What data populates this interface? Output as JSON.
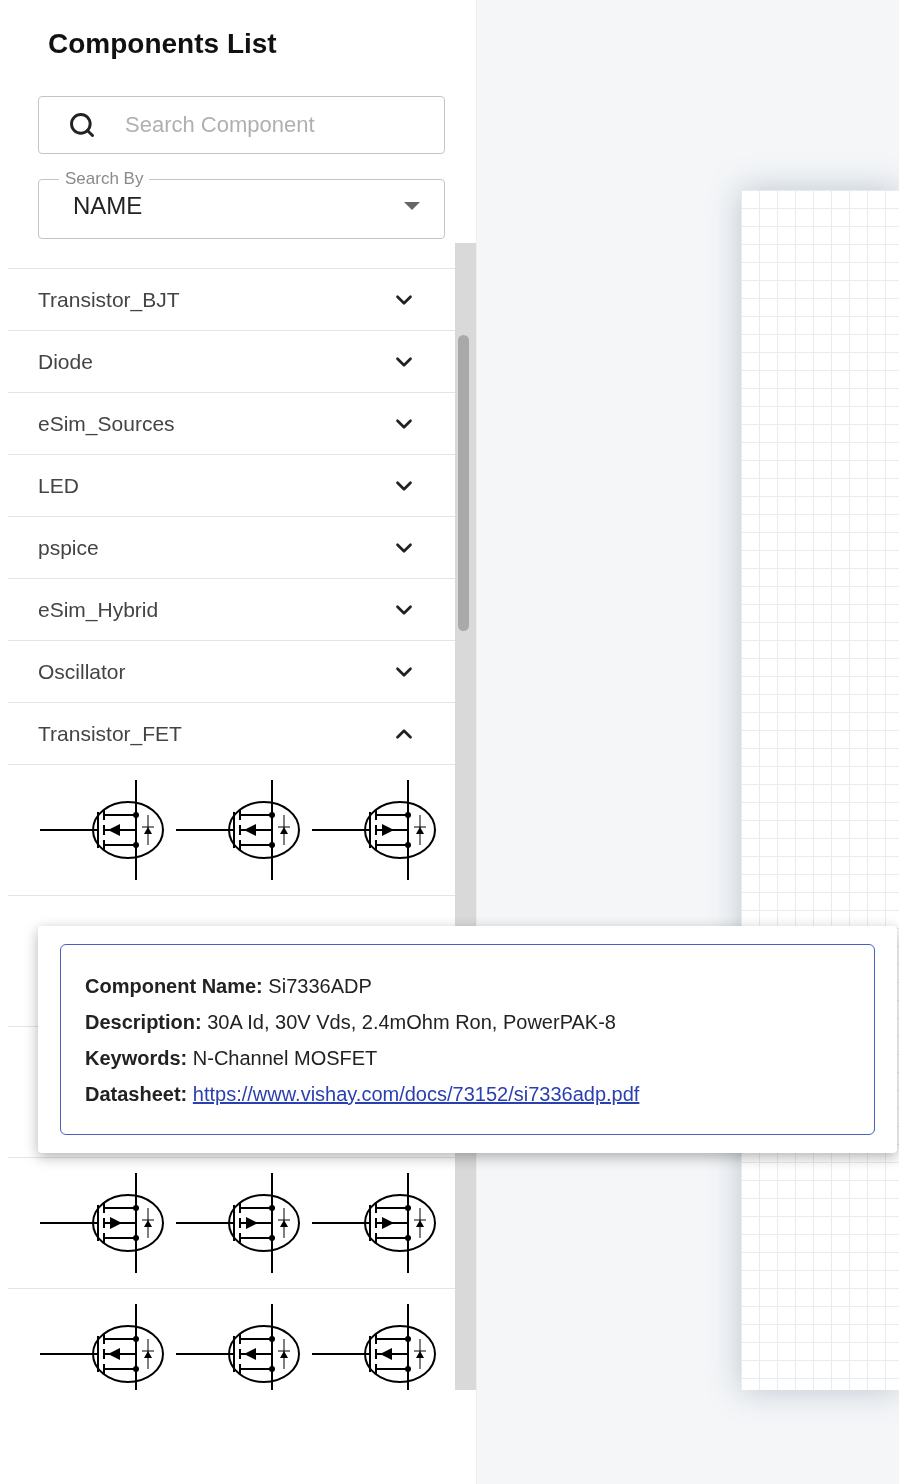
{
  "sidebar": {
    "title": "Components List",
    "search": {
      "placeholder": "Search Component"
    },
    "search_by": {
      "label": "Search By",
      "value": "NAME"
    },
    "categories": [
      {
        "name": "Transistor_BJT",
        "expanded": false
      },
      {
        "name": "Diode",
        "expanded": false
      },
      {
        "name": "eSim_Sources",
        "expanded": false
      },
      {
        "name": "LED",
        "expanded": false
      },
      {
        "name": "pspice",
        "expanded": false
      },
      {
        "name": "eSim_Hybrid",
        "expanded": false
      },
      {
        "name": "Oscillator",
        "expanded": false
      },
      {
        "name": "Transistor_FET",
        "expanded": true,
        "symbol_rows": [
          {
            "symbols": [
              {
                "kind": "n-channel"
              },
              {
                "kind": "n-channel"
              },
              {
                "kind": "p-channel"
              }
            ]
          },
          {},
          {},
          {
            "symbols": [
              {
                "kind": "p-channel"
              },
              {
                "kind": "p-channel"
              },
              {
                "kind": "p-channel"
              }
            ]
          },
          {
            "symbols": [
              {
                "kind": "n-channel"
              },
              {
                "kind": "n-channel"
              },
              {
                "kind": "n-channel"
              }
            ]
          }
        ]
      }
    ]
  },
  "tooltip": {
    "lines": [
      {
        "label": "Component Name:",
        "value": "Si7336ADP"
      },
      {
        "label": "Description:",
        "value": "30A Id, 30V Vds, 2.4mOhm Ron, PowerPAK-8"
      },
      {
        "label": "Keywords:",
        "value": "N-Channel MOSFET"
      },
      {
        "label": "Datasheet:",
        "link": "https://www.vishay.com/docs/73152/si7336adp.pdf"
      }
    ]
  }
}
